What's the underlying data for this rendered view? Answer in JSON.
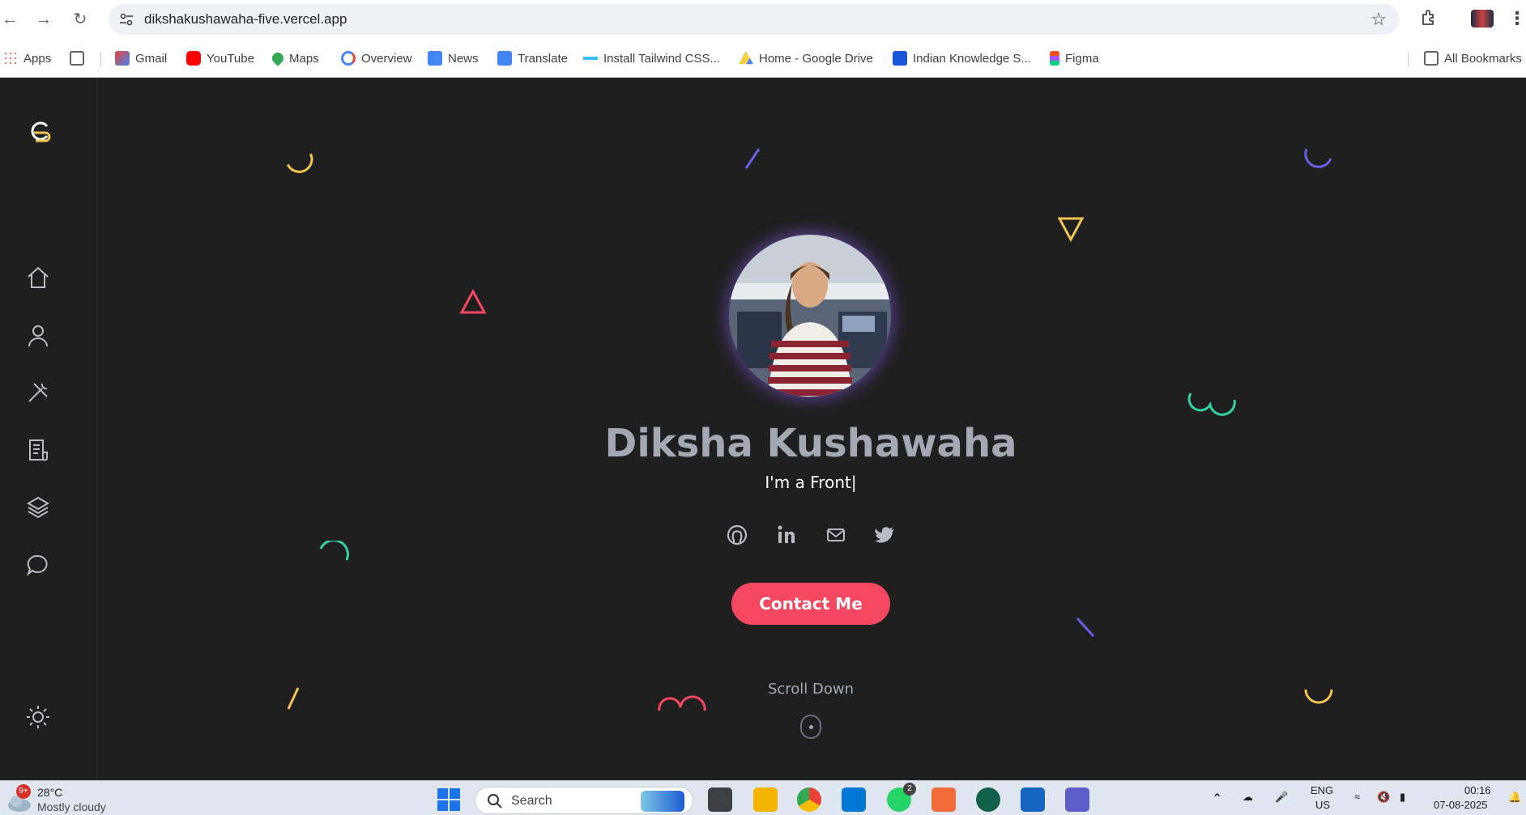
{
  "browser": {
    "url": "dikshakushawaha-five.vercel.app",
    "bookmarks": [
      "Apps",
      "Gmail",
      "YouTube",
      "Maps",
      "Overview",
      "News",
      "Translate",
      "Install Tailwind CSS...",
      "Home - Google Drive",
      "Indian Knowledge S...",
      "Figma"
    ],
    "all_bookmarks": "All Bookmarks"
  },
  "sidebar": {
    "items": [
      "home-icon",
      "user-icon",
      "tools-icon",
      "document-icon",
      "layers-icon",
      "chat-icon"
    ],
    "theme_toggle": "sun-icon"
  },
  "hero": {
    "name": "Diksha Kushawaha",
    "typing_text": "I'm a Front|",
    "socials": [
      "github-icon",
      "linkedin-icon",
      "mail-icon",
      "twitter-icon"
    ],
    "contact_label": "Contact Me",
    "scroll_label": "Scroll Down"
  },
  "taskbar": {
    "weather_badge": "9+",
    "temperature": "28°C",
    "condition": "Mostly cloudy",
    "search_label": "Search",
    "whatsapp_badge": "2",
    "lang_line1": "ENG",
    "lang_line2": "US",
    "time": "00:16",
    "date": "07-08-2025"
  },
  "colors": {
    "background": "#1f1f1f",
    "accent": "#f5475f",
    "name_text": "#a4a8b3",
    "yellow": "#f6c453",
    "purple": "#6a5fe3",
    "teal": "#34d1a6",
    "red": "#f5475f"
  }
}
